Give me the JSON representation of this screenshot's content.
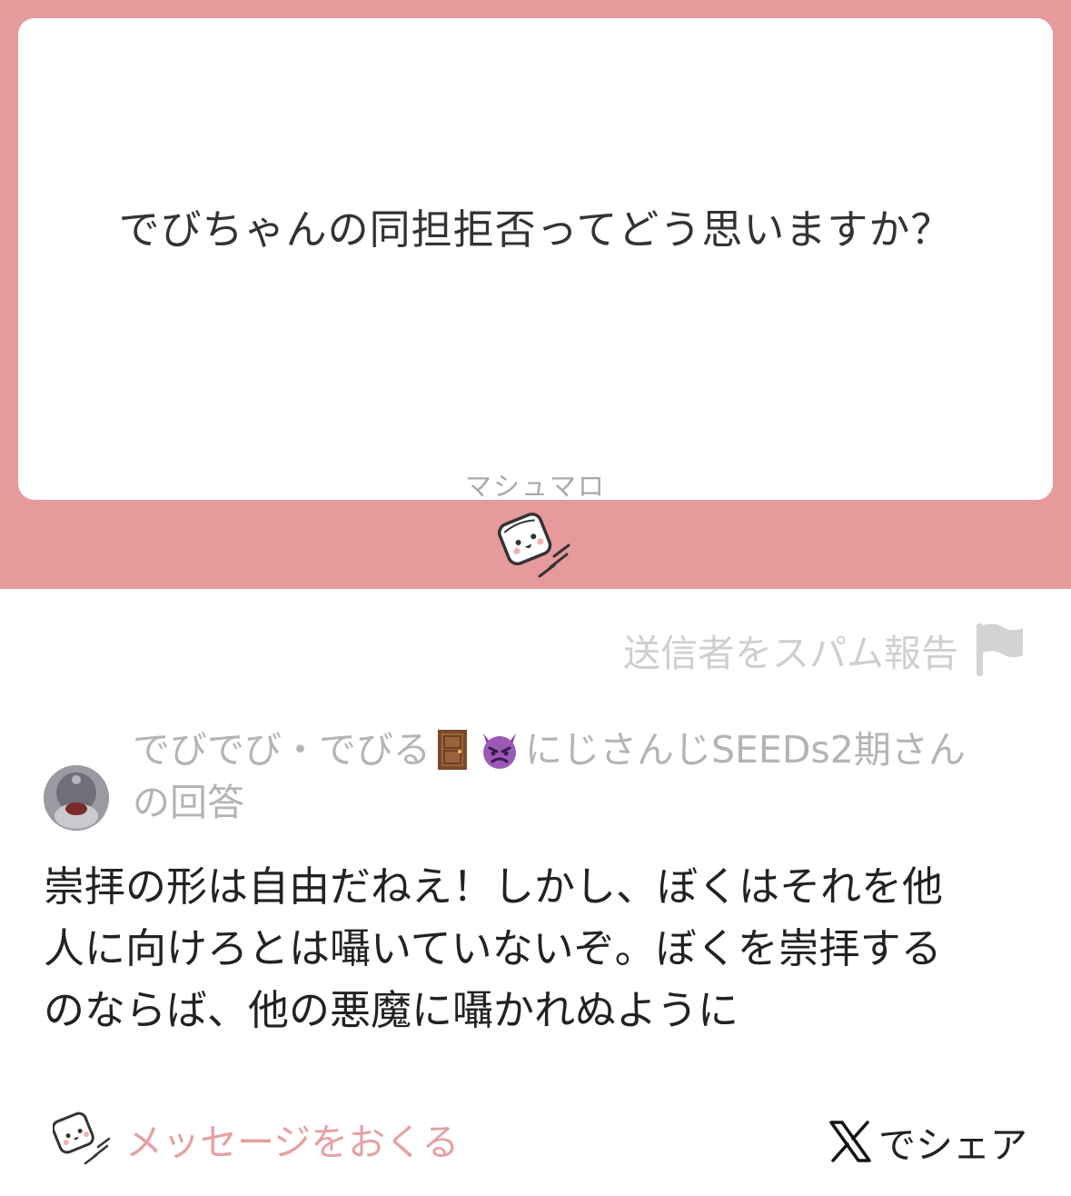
{
  "question": {
    "text": "でびちゃんの同担拒否ってどう思いますか？",
    "brand": "マシュマロ"
  },
  "report": {
    "label": "送信者をスパム報告",
    "icon": "flag-icon"
  },
  "answerer": {
    "name_part1": "でびでび・でびる",
    "name_part2": "にじさんじSEEDs2期さん",
    "suffix": "の回答",
    "emojis": [
      "door-emoji",
      "smiling-imp-emoji"
    ]
  },
  "answer": {
    "lines": [
      "崇拝の形は自由だねえ！しかし、ぼくはそれを他",
      "人に向けろとは囁いていないぞ。ぼくを崇拝する",
      "のならば、他の悪魔に囁かれぬように"
    ]
  },
  "footer": {
    "send_label": "メッセージをおくる",
    "share_label": "でシェア",
    "share_icon": "x-logo-icon"
  },
  "colors": {
    "banner": "#e69a9c",
    "send_text": "#e6a0a3",
    "muted_text": "#b4b4b4"
  }
}
